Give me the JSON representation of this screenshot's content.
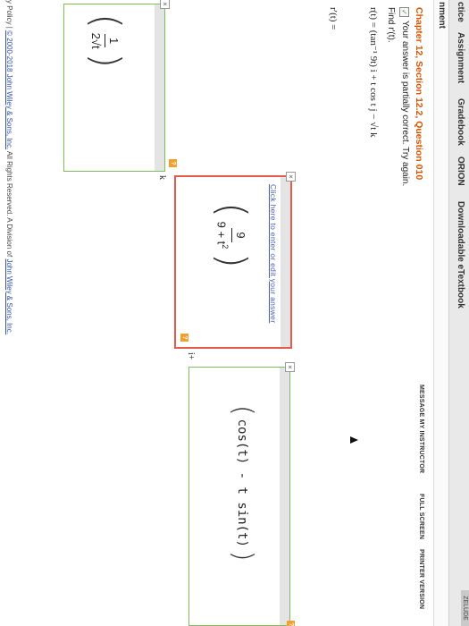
{
  "nav": {
    "items": [
      "ctice",
      "Assignment",
      "Gradebook",
      "ORION",
      "Downloadable eTextbook"
    ],
    "sub": "nment",
    "corner": "ZELUDE"
  },
  "question": {
    "title": "Chapter 12, Section 12.2, Question 010",
    "status": "Your answer is partially correct.  Try again.",
    "find": "Find r′(t).",
    "definition": "r(t) = (tan⁻¹ 9t) i + t cos t  j − √t k",
    "rprime_label": "r′(t) ="
  },
  "actions": {
    "message": "MESSAGE MY INSTRUCTOR",
    "fullscreen": "FULL SCREEN",
    "printer": "PRINTER VERSION"
  },
  "answers": {
    "hint": "Click here to enter or edit your answer",
    "i_component": {
      "numerator": "9",
      "denominator": "9 + t",
      "exp": "2",
      "suffix": "i+"
    },
    "j_component": {
      "expression": "cos(t) - t sin(t)"
    },
    "k_component": {
      "numerator": "1",
      "denominator": "2√t",
      "suffix": "k"
    },
    "badge": "?",
    "close": "×"
  },
  "footer": {
    "prefix": "y Policy  |  ",
    "copyright": "© 2000-2018 John Wiley & Sons, Inc.",
    "rest": " All Rights Reserved. A Division of ",
    "company": "John Wiley & Sons, Inc."
  },
  "colors": {
    "accent": "#d35400",
    "error": "#e25b4b",
    "correct": "#7fbf5a",
    "link": "#4a5fb5"
  }
}
